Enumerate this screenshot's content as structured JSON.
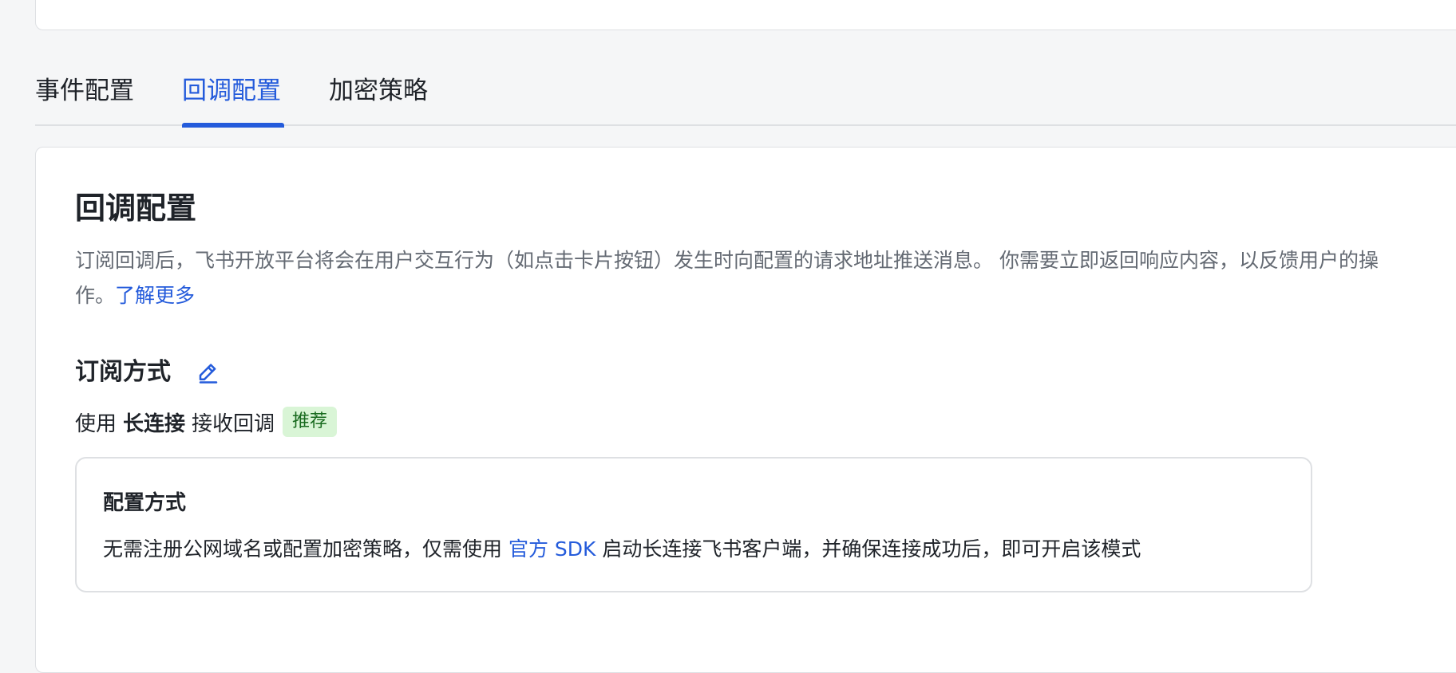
{
  "tabs": [
    {
      "label": "事件配置",
      "active": false
    },
    {
      "label": "回调配置",
      "active": true
    },
    {
      "label": "加密策略",
      "active": false
    }
  ],
  "callback": {
    "title": "回调配置",
    "description": "订阅回调后，飞书开放平台将会在用户交互行为（如点击卡片按钮）发生时向配置的请求地址推送消息。 你需要立即返回响应内容，以反馈用户的操作。",
    "learn_more": "了解更多",
    "subscription": {
      "title": "订阅方式",
      "edit_icon": "pencil-icon",
      "mode_prefix": "使用",
      "mode_name": "长连接",
      "mode_suffix": "接收回调",
      "badge": "推荐"
    },
    "config": {
      "title": "配置方式",
      "text_before": "无需注册公网域名或配置加密策略，仅需使用",
      "sdk_link": "官方 SDK",
      "text_after": "启动长连接飞书客户端，并确保连接成功后，即可开启该模式"
    }
  },
  "colors": {
    "accent": "#245bdb",
    "badge_bg": "#d9f5d6",
    "badge_text": "#186a1e",
    "muted_text": "#646a73",
    "border": "#dee0e3",
    "page_bg": "#f5f6f7"
  }
}
